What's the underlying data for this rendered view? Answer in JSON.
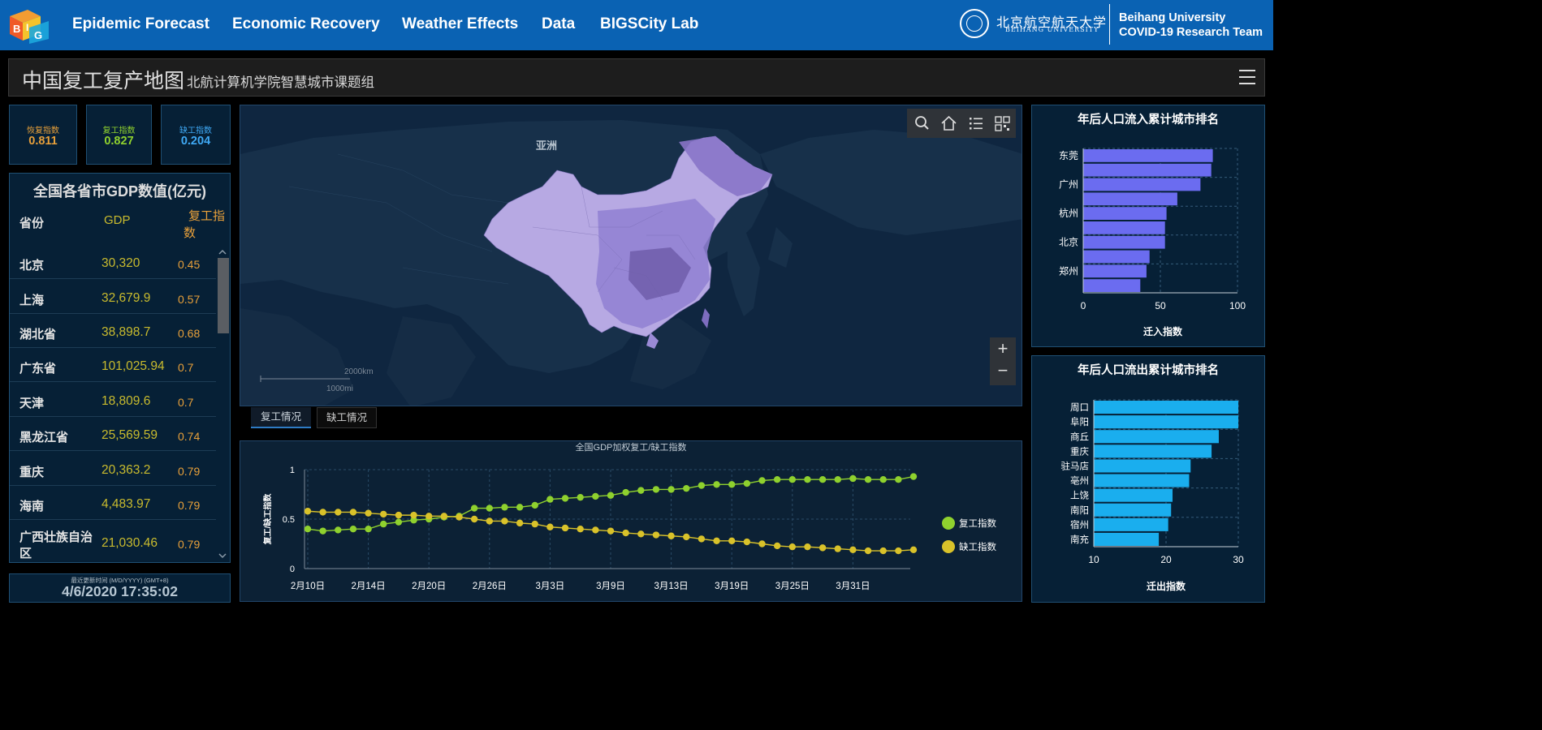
{
  "nav": {
    "items": [
      "Epidemic Forecast",
      "Economic Recovery",
      "Weather Effects",
      "Data",
      "BIGSCity Lab"
    ],
    "university_cn": "北京航空航天大学",
    "university_en": "BEIHANG UNIVERSITY",
    "team_line1": "Beihang University",
    "team_line2": "COVID-19 Research Team",
    "logo_letters": [
      "B",
      "I",
      "G"
    ]
  },
  "title": {
    "main": "中国复工复产地图",
    "sub": "北航计算机学院智慧城市课题组"
  },
  "indices": [
    {
      "label": "恢复指数",
      "value": "0.811",
      "color": "#e8a03a"
    },
    {
      "label": "复工指数",
      "value": "0.827",
      "color": "#8fd12e"
    },
    {
      "label": "缺工指数",
      "value": "0.204",
      "color": "#3fa9f5"
    }
  ],
  "gdp_table": {
    "title": "全国各省市GDP数值(亿元)",
    "headers": {
      "province": "省份",
      "gdp": "GDP",
      "index_line1": "复工指",
      "index_line2": "数"
    },
    "rows": [
      {
        "province": "北京",
        "gdp": "30,320",
        "index": "0.45"
      },
      {
        "province": "上海",
        "gdp": "32,679.9",
        "index": "0.57"
      },
      {
        "province": "湖北省",
        "gdp": "38,898.7",
        "index": "0.68"
      },
      {
        "province": "广东省",
        "gdp": "101,025.94",
        "index": "0.7"
      },
      {
        "province": "天津",
        "gdp": "18,809.6",
        "index": "0.7"
      },
      {
        "province": "黑龙江省",
        "gdp": "25,569.59",
        "index": "0.74"
      },
      {
        "province": "重庆",
        "gdp": "20,363.2",
        "index": "0.79"
      },
      {
        "province": "海南",
        "gdp": "4,483.97",
        "index": "0.79"
      },
      {
        "province": "广西壮族自治区",
        "gdp": "21,030.46",
        "index": "0.79",
        "line1": "广西壮族自治",
        "line2": "区"
      }
    ]
  },
  "update": {
    "label": "最近更新时间 (M/D/YYYY) (GMT+8)",
    "value": "4/6/2020 17:35:02"
  },
  "map": {
    "continent_label": "亚洲",
    "scale_km": "2000km",
    "scale_mi": "1000mi",
    "zoom_in": "+",
    "zoom_out": "−"
  },
  "tabs": [
    "复工情况",
    "缺工情况"
  ],
  "colors": {
    "nav": "#0a62b3",
    "in_bar": "#6b6cf0",
    "out_bar": "#1aaeee",
    "work_line": "#8fd12e",
    "absence_line": "#d9c22a"
  },
  "chart_data": [
    {
      "type": "line",
      "title": "全国GDP加权复工/缺工指数",
      "ylabel": "复工/缺工指数",
      "ylim": [
        0,
        1
      ],
      "yticks": [
        "0",
        "0.5",
        "1"
      ],
      "xtick_labels": [
        "2月10日",
        "2月14日",
        "2月20日",
        "2月26日",
        "3月3日",
        "3月9日",
        "3月13日",
        "3月19日",
        "3月25日",
        "3月31日"
      ],
      "xtick_index": [
        0,
        4,
        8,
        12,
        16,
        20,
        24,
        28,
        32,
        36
      ],
      "series": [
        {
          "name": "复工指数",
          "color": "#8fd12e",
          "values": [
            0.4,
            0.38,
            0.39,
            0.4,
            0.4,
            0.45,
            0.47,
            0.49,
            0.5,
            0.52,
            0.53,
            0.61,
            0.61,
            0.62,
            0.62,
            0.64,
            0.7,
            0.71,
            0.72,
            0.73,
            0.74,
            0.77,
            0.79,
            0.8,
            0.8,
            0.81,
            0.84,
            0.85,
            0.85,
            0.86,
            0.89,
            0.9,
            0.9,
            0.9,
            0.9,
            0.9,
            0.91,
            0.9,
            0.9,
            0.9,
            0.93
          ]
        },
        {
          "name": "缺工指数",
          "color": "#d9c22a",
          "values": [
            0.58,
            0.57,
            0.57,
            0.57,
            0.56,
            0.55,
            0.54,
            0.54,
            0.53,
            0.53,
            0.52,
            0.5,
            0.48,
            0.48,
            0.46,
            0.45,
            0.42,
            0.41,
            0.4,
            0.39,
            0.38,
            0.36,
            0.35,
            0.34,
            0.33,
            0.32,
            0.3,
            0.28,
            0.28,
            0.27,
            0.25,
            0.23,
            0.22,
            0.22,
            0.21,
            0.2,
            0.19,
            0.18,
            0.18,
            0.18,
            0.19
          ]
        }
      ]
    },
    {
      "type": "bar",
      "orientation": "horizontal",
      "title": "年后人口流入累计城市排名",
      "xlabel": "迁入指数",
      "xlim": [
        0,
        100
      ],
      "xticks": [
        "0",
        "50",
        "100"
      ],
      "categories": [
        "东莞",
        "",
        "广州",
        "",
        "杭州",
        "",
        "北京",
        "",
        "郑州",
        ""
      ],
      "values": [
        84,
        83,
        76,
        61,
        54,
        53,
        53,
        43,
        41,
        37
      ]
    },
    {
      "type": "bar",
      "orientation": "horizontal",
      "title": "年后人口流出累计城市排名",
      "xlabel": "迁出指数",
      "xlim": [
        10,
        30
      ],
      "xticks": [
        "10",
        "20",
        "30"
      ],
      "categories": [
        "周口",
        "阜阳",
        "商丘",
        "重庆",
        "驻马店",
        "亳州",
        "上饶",
        "南阳",
        "宿州",
        "南充"
      ],
      "values": [
        30.0,
        30.0,
        27.3,
        26.3,
        23.4,
        23.2,
        20.9,
        20.7,
        20.3,
        19.0
      ]
    }
  ]
}
